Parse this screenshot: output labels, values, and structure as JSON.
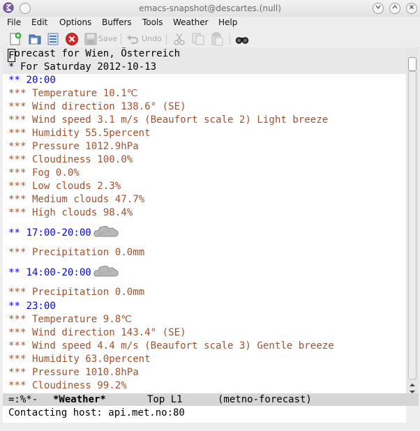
{
  "window": {
    "title": "emacs-snapshot@descartes.(null)"
  },
  "menubar": {
    "items": [
      {
        "label": "File"
      },
      {
        "label": "Edit"
      },
      {
        "label": "Options"
      },
      {
        "label": "Buffers"
      },
      {
        "label": "Tools"
      },
      {
        "label": "Weather"
      },
      {
        "label": "Help"
      }
    ]
  },
  "toolbar": {
    "save_label": "Save",
    "undo_label": "Undo",
    "icons": [
      "new-file-icon",
      "open-file-icon",
      "open-directory-icon",
      "close-buffer-icon",
      "save-icon",
      "undo-icon",
      "cut-icon",
      "copy-icon",
      "paste-icon",
      "search-icon"
    ]
  },
  "buffer": {
    "lines": [
      {
        "level": 1,
        "text": "Forecast for Wien, Österreich",
        "cursor_char": "F",
        "rest": "orecast for Wien, Österreich"
      },
      {
        "level": 2,
        "text": "* For Saturday 2012-10-13"
      },
      {
        "level": 3,
        "text": "** 20:00"
      },
      {
        "level": 4,
        "text": "*** Temperature 10.1℃"
      },
      {
        "level": 4,
        "text": "*** Wind direction 138.6° (SE)"
      },
      {
        "level": 4,
        "text": "*** Wind speed 3.1 m/s (Beaufort scale 2) Light breeze"
      },
      {
        "level": 4,
        "text": "*** Humidity 55.5percent"
      },
      {
        "level": 4,
        "text": "*** Pressure 1012.9hPa"
      },
      {
        "level": 4,
        "text": "*** Cloudiness 100.0%"
      },
      {
        "level": 4,
        "text": "*** Fog 0.0%"
      },
      {
        "level": 4,
        "text": "*** Low clouds 2.3%"
      },
      {
        "level": 4,
        "text": "*** Medium clouds 47.7%"
      },
      {
        "level": 4,
        "text": "*** High clouds 98.4%"
      },
      {
        "level": 3,
        "text": "** 17:00-20:00",
        "icon": "cloud-icon"
      },
      {
        "level": 4,
        "text": "*** Precipitation 0.0mm"
      },
      {
        "level": 3,
        "text": "** 14:00-20:00",
        "icon": "cloud-icon"
      },
      {
        "level": 4,
        "text": "*** Precipitation 0.0mm"
      },
      {
        "level": 3,
        "text": "** 23:00"
      },
      {
        "level": 4,
        "text": "*** Temperature 9.8℃"
      },
      {
        "level": 4,
        "text": "*** Wind direction 143.4° (SE)"
      },
      {
        "level": 4,
        "text": "*** Wind speed 4.4 m/s (Beaufort scale 3) Gentle breeze"
      },
      {
        "level": 4,
        "text": "*** Humidity 63.0percent"
      },
      {
        "level": 4,
        "text": "*** Pressure 1010.8hPa"
      },
      {
        "level": 4,
        "text": "*** Cloudiness 99.2%"
      }
    ]
  },
  "modeline": {
    "status": "=:%*-",
    "buffer_name": "*Weather*",
    "position": "Top L1",
    "mode": "(metno-forecast)"
  },
  "echo_area": {
    "message": "Contacting host: api.met.no:80"
  },
  "colors": {
    "level3": "#0000ee",
    "level4": "#a0522d",
    "modeline_bg": "#d6d6d6"
  }
}
